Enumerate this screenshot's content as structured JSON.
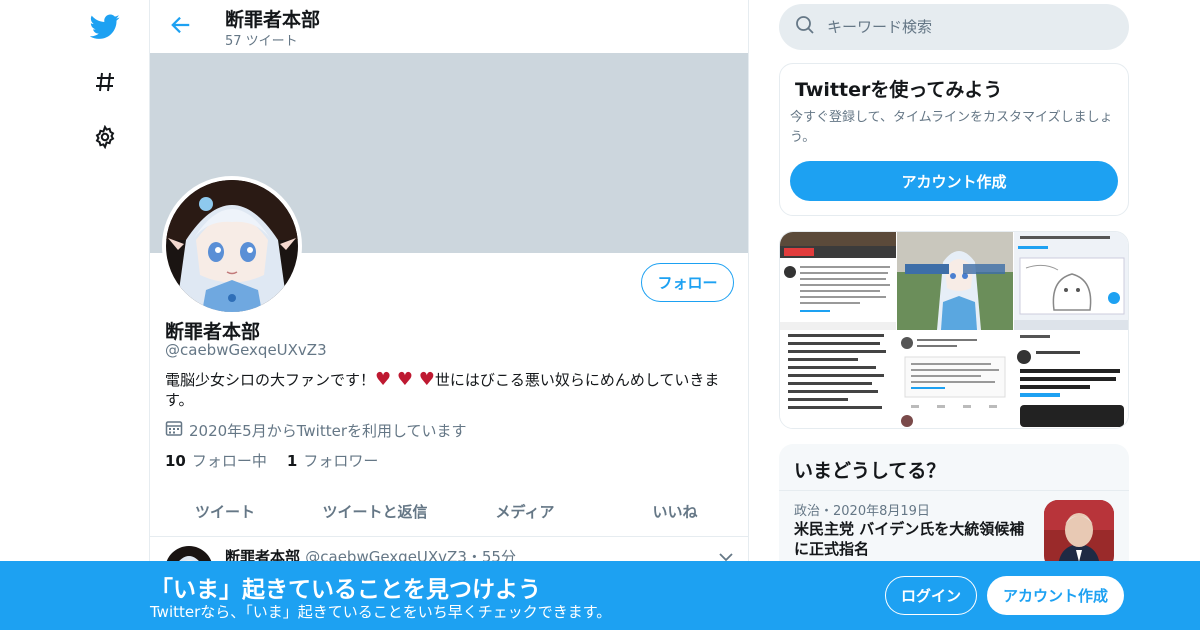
{
  "nav": {
    "items": [
      {
        "icon": "twitter-bird-icon"
      },
      {
        "icon": "hashtag-icon"
      },
      {
        "icon": "gear-icon"
      }
    ]
  },
  "header": {
    "title": "断罪者本部",
    "subtitle": "57 ツイート"
  },
  "profile": {
    "name": "断罪者本部",
    "handle": "@caebwGexqeUXvZ3",
    "bio_before": "電脳少女シロの大ファンです！",
    "bio_hearts": "♥ ♥ ♥",
    "bio_after": "世にはびこる悪い奴らにめんめしていきます。",
    "joined": "2020年5月からTwitterを利用しています",
    "following_count": "10",
    "following_label": "フォロー中",
    "followers_count": "1",
    "followers_label": "フォロワー",
    "follow_button": "フォロー"
  },
  "tabs": [
    {
      "label": "ツイート"
    },
    {
      "label": "ツイートと返信"
    },
    {
      "label": "メディア"
    },
    {
      "label": "いいね"
    }
  ],
  "tweet": {
    "name": "断罪者本部",
    "handle": "@caebwGexqeUXvZ3",
    "time": "55分"
  },
  "search": {
    "placeholder": "キーワード検索"
  },
  "signup_card": {
    "title": "Twitterを使ってみよう",
    "description": "今すぐ登録して、タイムラインをカスタマイズしましょう。",
    "button": "アカウント作成"
  },
  "trends": {
    "title": "いまどうしてる？",
    "items": [
      {
        "meta": "政治・2020年8月19日",
        "title": "米民主党 バイデン氏を大統領候補に正式指名"
      }
    ]
  },
  "bottom_bar": {
    "title": "「いま」起きていることを見つけよう",
    "subtitle": "Twitterなら、「いま」起きていることをいち早くチェックできます。",
    "login": "ログイン",
    "signup": "アカウント作成"
  },
  "colors": {
    "accent": "#1da1f2",
    "banner": "#ccd6dd",
    "heart": "#be1931"
  }
}
